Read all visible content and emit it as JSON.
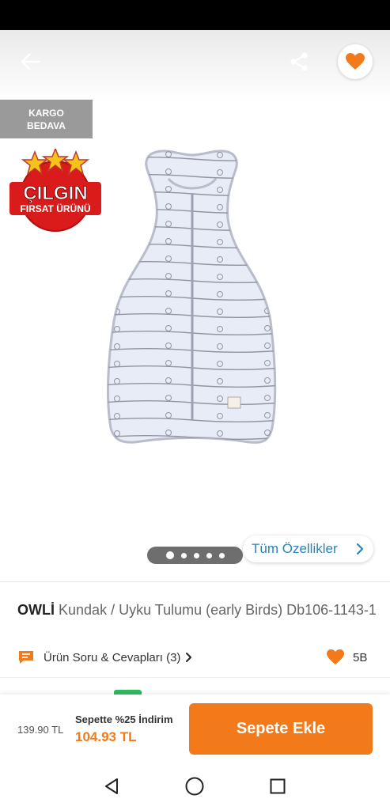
{
  "badges": {
    "cargo_line1": "KARGO",
    "cargo_line2": "BEDAVA",
    "deal_line1": "ÇILGIN",
    "deal_line2": "FIRSAT ÜRÜNÜ"
  },
  "gallery": {
    "page_count": 5,
    "active_index": 1
  },
  "features_button": {
    "label": "Tüm Özellikler"
  },
  "product": {
    "brand": "OWLİ",
    "name": "Kundak / Uyku Tulumu (early Birds) Db106-1143-1"
  },
  "qa": {
    "label": "Ürün Soru & Cevapları (3)"
  },
  "favorites": {
    "count": "5B"
  },
  "price": {
    "old": "139.90 TL",
    "promo_label": "Sepette %25 İndirim",
    "new": "104.93 TL"
  },
  "cart_button": {
    "label": "Sepete Ekle"
  },
  "colors": {
    "accent": "#f27a1a",
    "link": "#2a84b8",
    "deal_red": "#d91b1b",
    "star": "#f7c21a"
  },
  "icons": [
    "back-arrow-icon",
    "share-icon",
    "heart-icon",
    "chat-icon",
    "chevron-right-icon",
    "nav-back-icon",
    "nav-home-icon",
    "nav-recents-icon"
  ]
}
